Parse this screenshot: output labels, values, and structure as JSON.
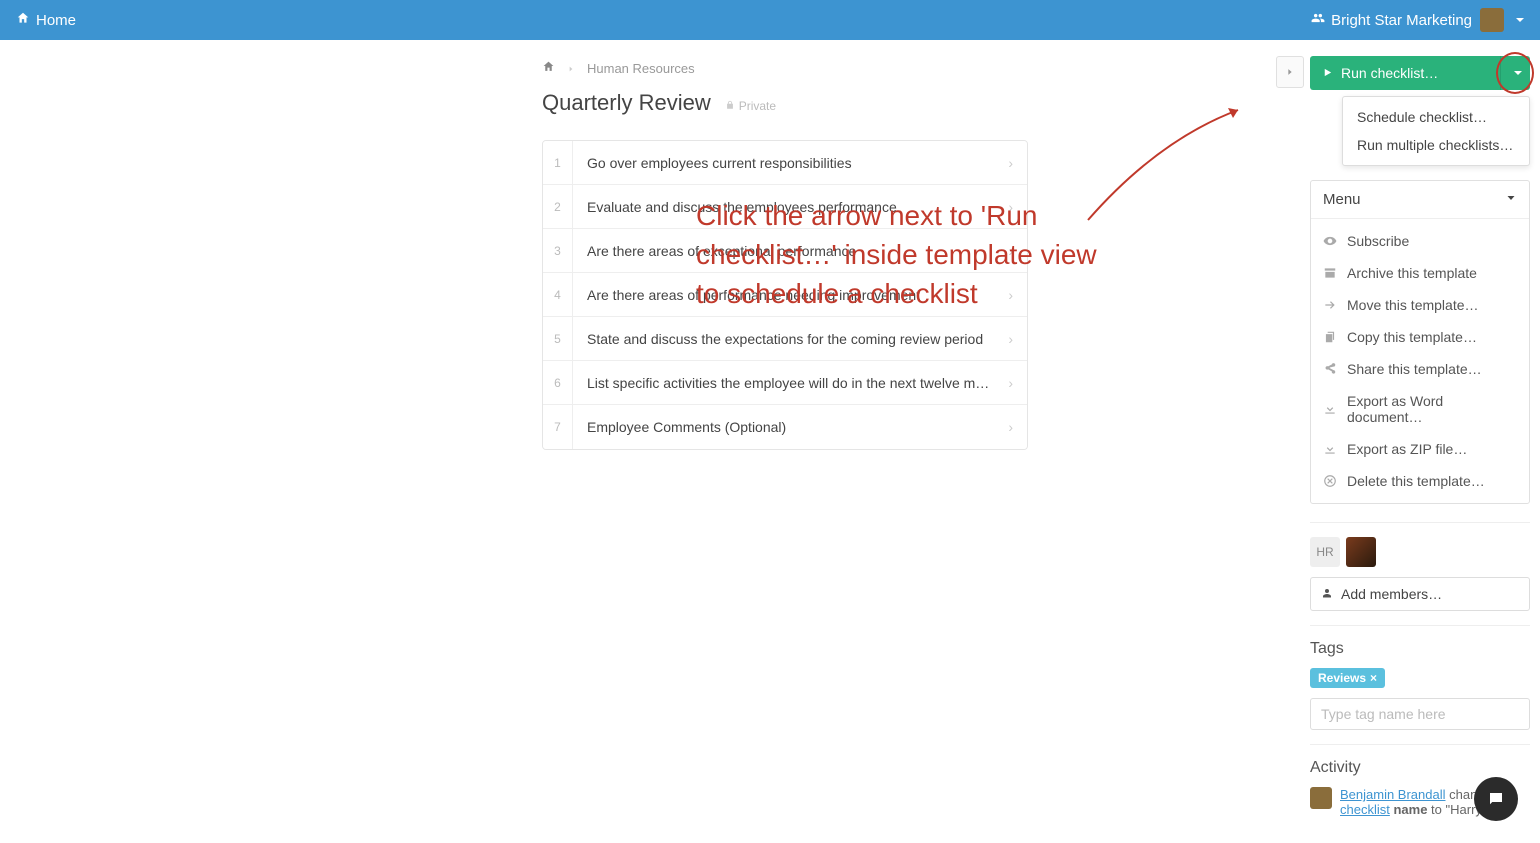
{
  "navbar": {
    "home": "Home",
    "org": "Bright Star Marketing"
  },
  "breadcrumb": {
    "category": "Human Resources"
  },
  "title": "Quarterly Review",
  "privacy": "Private",
  "steps": [
    "Go over employees current responsibilities",
    "Evaluate and discuss the employees performance",
    "Are there areas of exceptional performance",
    "Are there areas of performance needing improvement",
    "State and discuss the expectations for the coming review period",
    "List specific activities the employee will do in the next twelve months",
    "Employee Comments (Optional)"
  ],
  "annotation": "Click the arrow next to 'Run checklist…' inside template view to schedule a checklist",
  "run_button": "Run checklist…",
  "dropdown": {
    "schedule": "Schedule checklist…",
    "multiple": "Run multiple checklists…"
  },
  "menu": {
    "header": "Menu",
    "subscribe": "Subscribe",
    "archive": "Archive this template",
    "move": "Move this template…",
    "copy": "Copy this template…",
    "share": "Share this template…",
    "export_word": "Export as Word document…",
    "export_zip": "Export as ZIP file…",
    "delete": "Delete this template…"
  },
  "members": {
    "hr": "HR",
    "add": "Add members…"
  },
  "tags": {
    "label": "Tags",
    "badge": "Reviews",
    "placeholder": "Type tag name here"
  },
  "activity": {
    "label": "Activity",
    "user": "Benjamin Brandall",
    "line1_rest": " changed",
    "line2_a": "checklist",
    "line2_b": " name",
    "line2_c": " to \"Harry"
  }
}
